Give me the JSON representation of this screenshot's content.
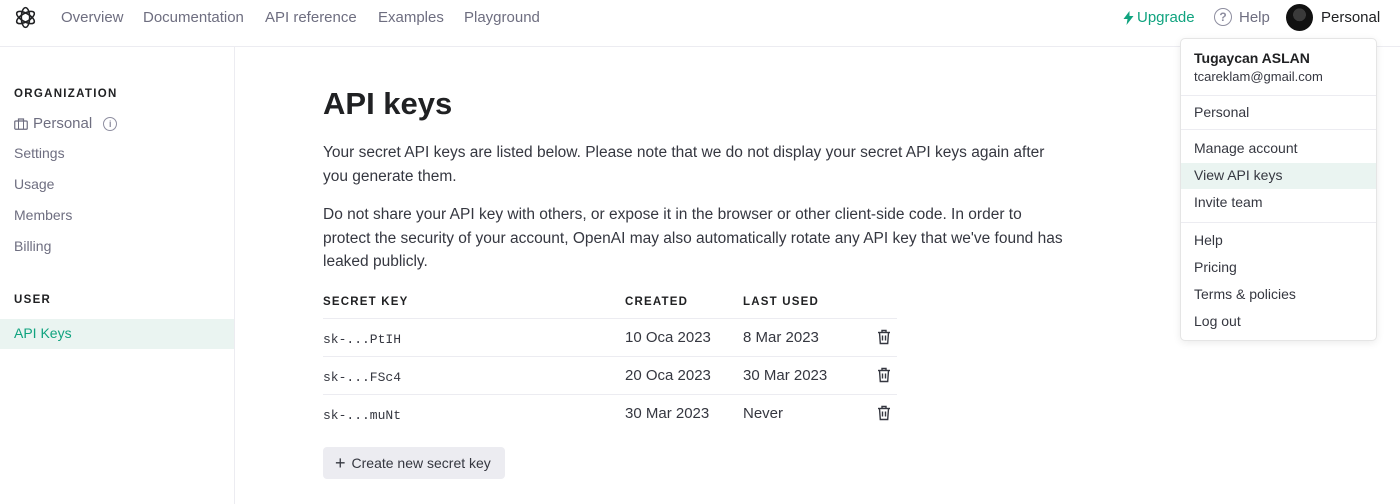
{
  "nav": {
    "links": [
      "Overview",
      "Documentation",
      "API reference",
      "Examples",
      "Playground"
    ],
    "upgrade": "Upgrade",
    "help": "Help",
    "help_icon_glyph": "?",
    "profile": "Personal"
  },
  "sidebar": {
    "org_heading": "ORGANIZATION",
    "org_name": "Personal",
    "info_glyph": "i",
    "items": [
      "Settings",
      "Usage",
      "Members",
      "Billing"
    ],
    "user_heading": "USER",
    "active_item": "API Keys"
  },
  "main": {
    "title": "API keys",
    "para1": "Your secret API keys are listed below. Please note that we do not display your secret API keys again after you generate them.",
    "para2": "Do not share your API key with others, or expose it in the browser or other client-side code. In order to protect the security of your account, OpenAI may also automatically rotate any API key that we've found has leaked publicly.",
    "table": {
      "headers": [
        "SECRET KEY",
        "CREATED",
        "LAST USED"
      ],
      "rows": [
        {
          "key": "sk-...PtIH",
          "created": "10 Oca 2023",
          "last_used": "8 Mar 2023"
        },
        {
          "key": "sk-...FSc4",
          "created": "20 Oca 2023",
          "last_used": "30 Mar 2023"
        },
        {
          "key": "sk-...muNt",
          "created": "30 Mar 2023",
          "last_used": "Never"
        }
      ]
    },
    "create_button": "Create new secret key",
    "plus_glyph": "+"
  },
  "menu": {
    "name": "Tugaycan ASLAN",
    "email": "tcareklam@gmail.com",
    "org": "Personal",
    "account_items": [
      "Manage account",
      "View API keys",
      "Invite team"
    ],
    "highlighted": "View API keys",
    "support_items": [
      "Help",
      "Pricing",
      "Terms & policies",
      "Log out"
    ]
  },
  "colors": {
    "accent": "#10a37f",
    "highlight_bg": "#eaf4f1",
    "border": "#ececf1",
    "muted_text": "#6e6e80"
  },
  "icons": {
    "logo": "openai-logo-icon",
    "upgrade": "lightning-icon",
    "help": "question-circle-icon",
    "org": "briefcase-icon",
    "info": "info-icon",
    "delete": "trash-icon",
    "add": "plus-icon"
  }
}
